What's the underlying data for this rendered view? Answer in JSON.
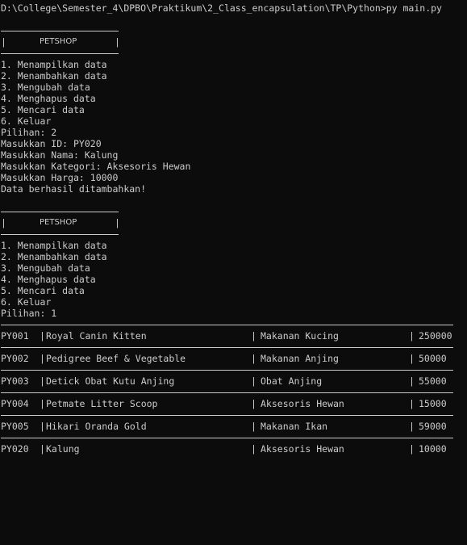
{
  "prompt": "D:\\College\\Semester_4\\DPBO\\Praktikum\\2_Class_encapsulation\\TP\\Python>py main.py",
  "header_title": "PETSHOP",
  "header_bar": "|",
  "menu": [
    "1. Menampilkan data",
    "2. Menambahkan data",
    "3. Mengubah data",
    "4. Menghapus data",
    "5. Mencari data",
    "6. Keluar"
  ],
  "session1": {
    "choice": "Pilihan: 2",
    "input_id": "Masukkan ID: PY020",
    "input_name": "Masukkan Nama: Kalung",
    "input_category": "Masukkan Kategori: Aksesoris Hewan",
    "input_price": "Masukkan Harga: 10000",
    "result": "Data berhasil ditambahkan!"
  },
  "session2": {
    "choice": "Pilihan: 1"
  },
  "separator": "|",
  "table": [
    {
      "id": "PY001",
      "name": "Royal Canin Kitten",
      "category": "Makanan Kucing",
      "price": "250000"
    },
    {
      "id": "PY002",
      "name": "Pedigree Beef & Vegetable",
      "category": "Makanan Anjing",
      "price": "50000"
    },
    {
      "id": "PY003",
      "name": "Detick Obat Kutu Anjing",
      "category": "Obat Anjing",
      "price": "55000"
    },
    {
      "id": "PY004",
      "name": "Petmate Litter Scoop",
      "category": "Aksesoris Hewan",
      "price": "15000"
    },
    {
      "id": "PY005",
      "name": "Hikari Oranda Gold",
      "category": "Makanan Ikan",
      "price": "59000"
    },
    {
      "id": "PY020",
      "name": "Kalung",
      "category": "Aksesoris Hewan",
      "price": "10000"
    }
  ]
}
